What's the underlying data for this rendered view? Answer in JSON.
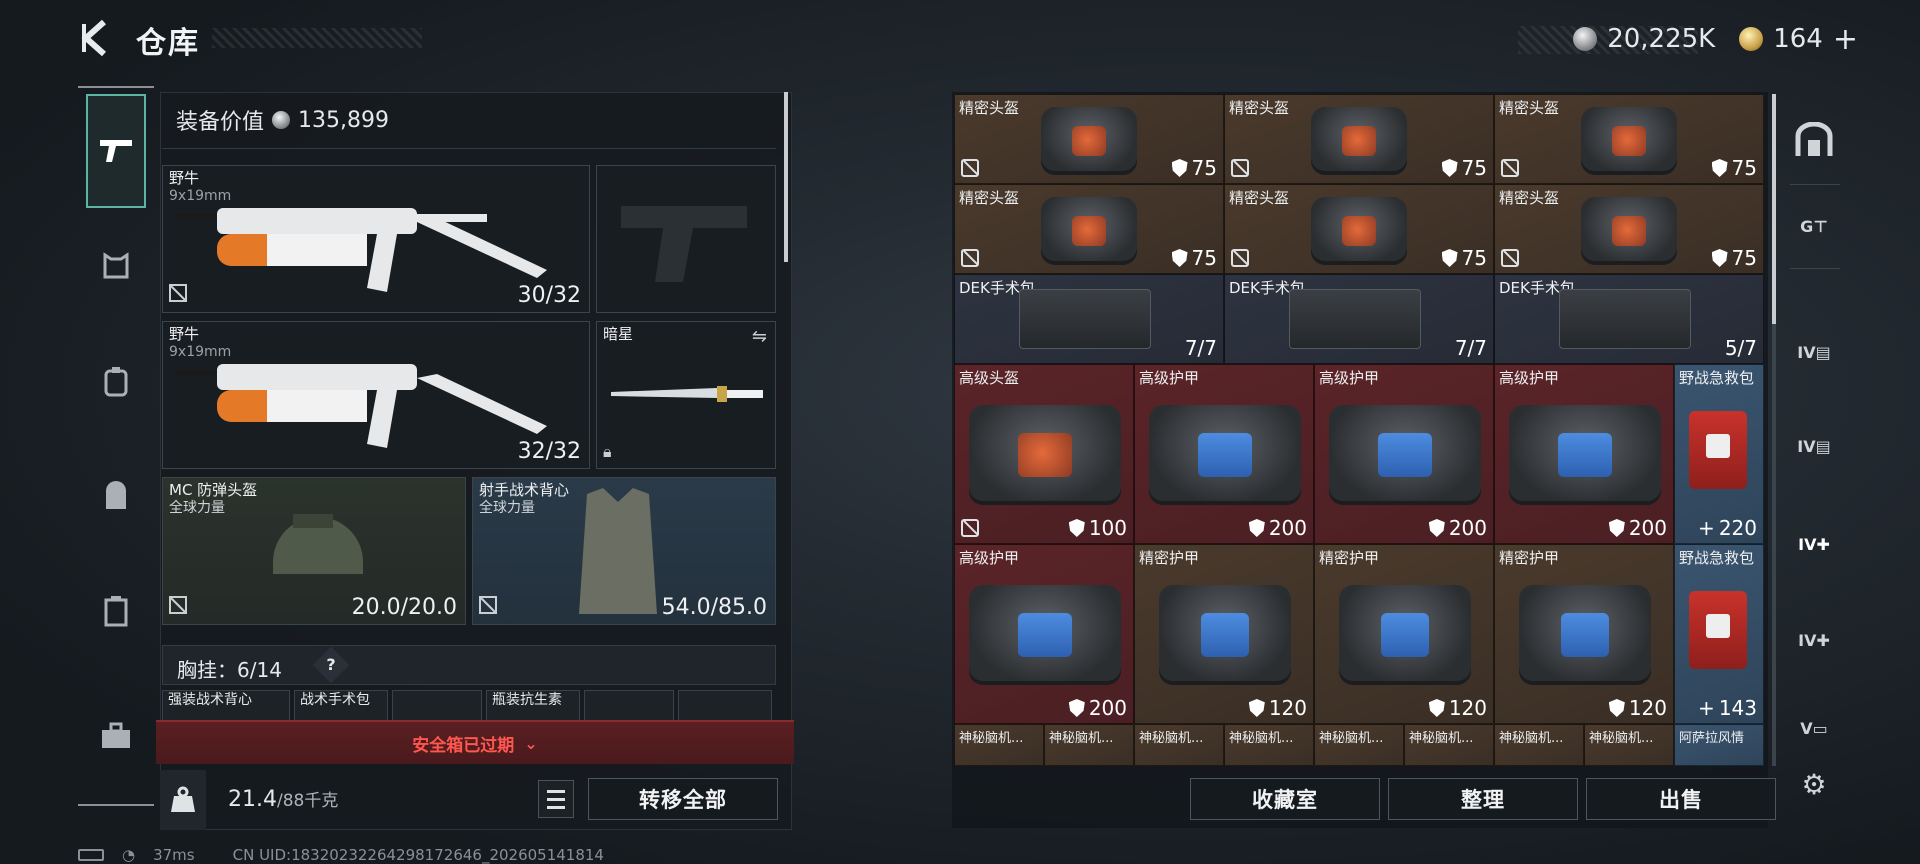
{
  "header": {
    "title": "仓库",
    "silver": "20,225K",
    "gold": "164",
    "gold_plus": "+"
  },
  "left_nav": {
    "items": [
      "firearm-icon",
      "armor-icon",
      "backpack-rig-icon",
      "backpack-icon",
      "case-icon",
      "toolbox-icon"
    ]
  },
  "equipment": {
    "label": "装备价值",
    "value": "135,899",
    "primary1": {
      "name": "野牛",
      "caliber": "9x19mm",
      "ammo": "30/32"
    },
    "primary2": {
      "name": "野牛",
      "caliber": "9x19mm",
      "ammo": "32/32"
    },
    "melee": {
      "name": "暗星"
    },
    "helmet": {
      "name": "MC 防弹头盔",
      "sub": "全球力量",
      "durability": "20.0/20.0"
    },
    "vest": {
      "name": "射手战术背心",
      "sub": "全球力量",
      "durability": "54.0/85.0"
    },
    "chest_rig": {
      "label": "胸挂：",
      "count": "6/14",
      "help": "?"
    },
    "chest_slots": [
      "强装战术背心",
      "战术手术包",
      "",
      "瓶装抗生素",
      "",
      ""
    ],
    "safe_box": "安全箱已过期",
    "weight": "21.4",
    "weight_max": "/88千克",
    "transfer_all": "转移全部"
  },
  "stash": {
    "row1": [
      {
        "name": "精密头盔",
        "val": "75"
      },
      {
        "name": "精密头盔",
        "val": "75"
      },
      {
        "name": "精密头盔",
        "val": "75"
      }
    ],
    "row2": [
      {
        "name": "精密头盔",
        "val": "75"
      },
      {
        "name": "精密头盔",
        "val": "75"
      },
      {
        "name": "精密头盔",
        "val": "75"
      }
    ],
    "row3": [
      {
        "name": "DEK手术包",
        "val": "7/7"
      },
      {
        "name": "DEK手术包",
        "val": "7/7"
      },
      {
        "name": "DEK手术包",
        "val": "5/7"
      }
    ],
    "row4": [
      {
        "name": "高级头盔",
        "val": "100"
      },
      {
        "name": "高级护甲",
        "val": "200"
      },
      {
        "name": "高级护甲",
        "val": "200"
      },
      {
        "name": "高级护甲",
        "val": "200"
      },
      {
        "name": "野战急救包",
        "val": "220"
      }
    ],
    "row5": [
      {
        "name": "高级护甲",
        "val": "200"
      },
      {
        "name": "精密护甲",
        "val": "120"
      },
      {
        "name": "精密护甲",
        "val": "120"
      },
      {
        "name": "精密护甲",
        "val": "120"
      },
      {
        "name": "野战急救包",
        "val": "143"
      }
    ],
    "row6": [
      "神秘脑机...",
      "神秘脑机...",
      "神秘脑机...",
      "神秘脑机...",
      "神秘脑机...",
      "神秘脑机...",
      "神秘脑机...",
      "神秘脑机...",
      "阿萨拉风情"
    ],
    "plus": "+"
  },
  "actions": {
    "collection": "收藏室",
    "sort": "整理",
    "sell": "出售"
  },
  "right_nav": {
    "items": [
      "armor-plate-icon",
      "G-T-icon",
      "IV-case-icon",
      "IV-case-icon",
      "IV-medkit-icon",
      "IV-medkit-icon",
      "V-icon"
    ]
  },
  "footer": {
    "ping": "37ms",
    "uid": "CN UID:18320232264298172646_202605141814"
  }
}
